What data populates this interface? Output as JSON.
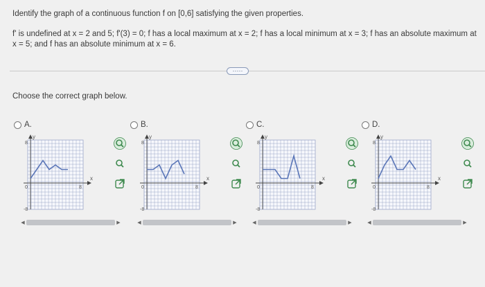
{
  "question": {
    "title": "Identify the graph of a continuous function f on [0,6] satisfying the given properties.",
    "properties": "f' is undefined at x = 2 and 5; f'(3) = 0; f has a local maximum at x = 2; f has a local minimum at x = 3; f has an absolute maximum at x = 5; and f has an absolute minimum at x = 6."
  },
  "more_button": "·····",
  "choose_text": "Choose the correct graph below.",
  "options": [
    {
      "label": "A.",
      "y_top": "8",
      "y_bottom": "-8",
      "x_left": "0",
      "x_right": "8",
      "axis_x": "x",
      "axis_y": "y",
      "curve": [
        [
          0,
          1
        ],
        [
          1,
          3
        ],
        [
          2,
          5
        ],
        [
          3,
          3
        ],
        [
          4,
          4
        ],
        [
          5,
          3
        ],
        [
          6,
          3
        ]
      ]
    },
    {
      "label": "B.",
      "y_top": "8",
      "y_bottom": "-8",
      "x_left": "0",
      "x_right": "8",
      "axis_x": "x",
      "axis_y": "y",
      "curve": [
        [
          0,
          3
        ],
        [
          1,
          3
        ],
        [
          2,
          4
        ],
        [
          3,
          1
        ],
        [
          4,
          4
        ],
        [
          5,
          5
        ],
        [
          6,
          2
        ]
      ]
    },
    {
      "label": "C.",
      "y_top": "8",
      "y_bottom": "-8",
      "x_left": "0",
      "x_right": "8",
      "axis_x": "x",
      "axis_y": "y",
      "curve": [
        [
          0,
          3
        ],
        [
          1,
          3
        ],
        [
          2,
          3
        ],
        [
          3,
          1
        ],
        [
          4,
          1
        ],
        [
          5,
          6
        ],
        [
          6,
          1
        ]
      ]
    },
    {
      "label": "D.",
      "y_top": "8",
      "y_bottom": "-8",
      "x_left": "0",
      "x_right": "8",
      "axis_x": "x",
      "axis_y": "y",
      "curve": [
        [
          0,
          1
        ],
        [
          1,
          4
        ],
        [
          2,
          6
        ],
        [
          3,
          3
        ],
        [
          4,
          3
        ],
        [
          5,
          5
        ],
        [
          6,
          3
        ]
      ]
    }
  ],
  "tool_icons": [
    "zoom-in-icon",
    "zoom-out-icon",
    "external-link-icon"
  ],
  "colors": {
    "curve": "#5a76b8",
    "grid": "#9aa6c8",
    "tool_green": "#3f8a4f",
    "accent": "#4a64a8"
  }
}
